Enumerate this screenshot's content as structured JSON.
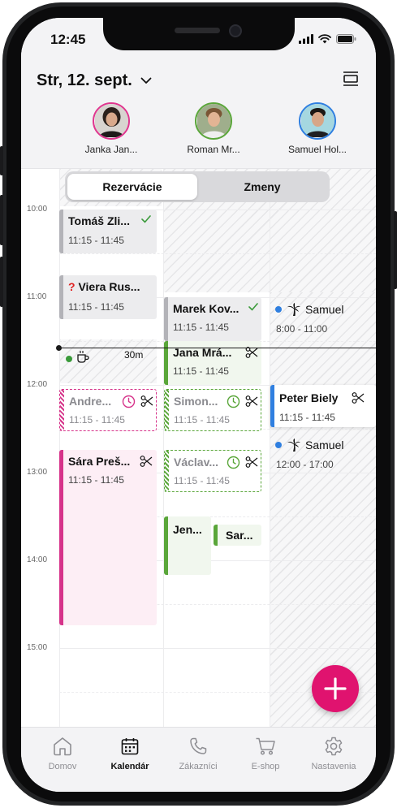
{
  "status": {
    "time": "12:45"
  },
  "header": {
    "date": "Str, 12. sept."
  },
  "staff": [
    {
      "name": "Janka Jan...",
      "ring": "#e0368f"
    },
    {
      "name": "Roman Mr...",
      "ring": "#5aa63a"
    },
    {
      "name": "Samuel Hol...",
      "ring": "#2f7fe0"
    }
  ],
  "segment": {
    "left": "Rezervácie",
    "right": "Zmeny"
  },
  "hours": [
    "10:00",
    "11:00",
    "12:00",
    "13:00",
    "14:00",
    "15:00"
  ],
  "events": {
    "tomas": {
      "title": "Tomáš Zli...",
      "time": "11:15 - 11:45"
    },
    "viera": {
      "mark": "?",
      "title": "Viera Rus...",
      "time": "11:15 - 11:45"
    },
    "marek": {
      "title": "Marek Kov...",
      "time": "11:15 - 11:45"
    },
    "samuel1": {
      "title": "Samuel",
      "time": "8:00 - 11:00"
    },
    "pause": {
      "duration": "30m"
    },
    "jana": {
      "title": "Jana Mrá...",
      "time": "11:15 - 11:45"
    },
    "andrea": {
      "title": "Andre...",
      "time": "11:15 - 11:45"
    },
    "simon": {
      "title": "Simon...",
      "time": "11:15 - 11:45"
    },
    "peter": {
      "title": "Peter Biely",
      "time": "11:15 - 11:45"
    },
    "samuel2": {
      "title": "Samuel",
      "time": "12:00 - 17:00"
    },
    "sara": {
      "title": "Sára Preš...",
      "time": "11:15 - 11:45"
    },
    "vaclav": {
      "title": "Václav...",
      "time": "11:15 - 11:45"
    },
    "jen": {
      "title": "Jen..."
    },
    "sar": {
      "title": "Sar..."
    }
  },
  "colors": {
    "pink": "#d6338a",
    "green": "#5aa63a",
    "blue": "#2f7fe0",
    "fab": "#e0136f"
  },
  "tabs": [
    {
      "label": "Domov",
      "icon": "home-icon"
    },
    {
      "label": "Kalendár",
      "icon": "calendar-icon"
    },
    {
      "label": "Zákazníci",
      "icon": "phone-icon"
    },
    {
      "label": "E-shop",
      "icon": "cart-icon"
    },
    {
      "label": "Nastavenia",
      "icon": "gear-icon"
    }
  ]
}
